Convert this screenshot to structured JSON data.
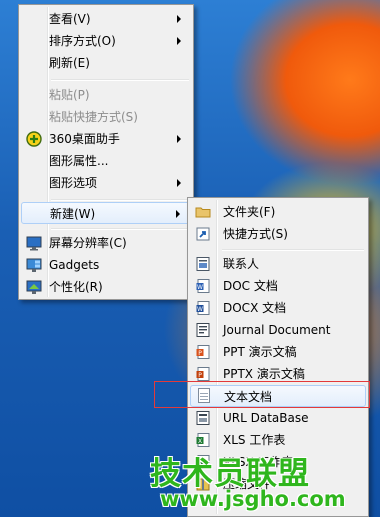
{
  "colors": {
    "accent": "#2fb61d",
    "highlight_border": "#aecff7",
    "callout_red": "#e33a3a"
  },
  "context_menu": {
    "items": [
      {
        "label": "查看(V)",
        "icon": "",
        "submenu": true,
        "disabled": false
      },
      {
        "label": "排序方式(O)",
        "icon": "",
        "submenu": true,
        "disabled": false
      },
      {
        "label": "刷新(E)",
        "icon": "",
        "submenu": false,
        "disabled": false
      },
      {
        "label": "粘贴(P)",
        "icon": "",
        "submenu": false,
        "disabled": true
      },
      {
        "label": "粘贴快捷方式(S)",
        "icon": "",
        "submenu": false,
        "disabled": true
      },
      {
        "label": "360桌面助手",
        "icon": "360-assistant-icon",
        "submenu": true,
        "disabled": false
      },
      {
        "label": "图形属性...",
        "icon": "",
        "submenu": false,
        "disabled": false
      },
      {
        "label": "图形选项",
        "icon": "",
        "submenu": true,
        "disabled": false
      },
      {
        "label": "新建(W)",
        "icon": "",
        "submenu": true,
        "disabled": false,
        "highlighted": true
      },
      {
        "label": "屏幕分辨率(C)",
        "icon": "monitor-icon",
        "submenu": false,
        "disabled": false
      },
      {
        "label": "Gadgets",
        "icon": "gadgets-icon",
        "submenu": false,
        "disabled": false
      },
      {
        "label": "个性化(R)",
        "icon": "personalize-icon",
        "submenu": false,
        "disabled": false
      }
    ]
  },
  "new_submenu": {
    "items": [
      {
        "label": "文件夹(F)",
        "icon": "folder-icon"
      },
      {
        "label": "快捷方式(S)",
        "icon": "shortcut-icon"
      },
      {
        "label": "联系人",
        "icon": "contact-icon"
      },
      {
        "label": "DOC 文档",
        "icon": "doc-icon"
      },
      {
        "label": "DOCX 文档",
        "icon": "docx-icon"
      },
      {
        "label": "Journal Document",
        "icon": "journal-icon"
      },
      {
        "label": "PPT 演示文稿",
        "icon": "ppt-icon"
      },
      {
        "label": "PPTX 演示文稿",
        "icon": "pptx-icon"
      },
      {
        "label": "文本文档",
        "icon": "text-document-icon",
        "highlighted": true
      },
      {
        "label": "URL DataBase",
        "icon": "url-database-icon"
      },
      {
        "label": "XLS 工作表",
        "icon": "xls-icon"
      },
      {
        "label": "XLSX 工作表",
        "icon": "xlsx-icon"
      },
      {
        "label": "压缩文件",
        "icon": "zip-icon"
      }
    ]
  },
  "watermark": {
    "text": "技术员联盟",
    "url": "www.jsgho.com"
  }
}
